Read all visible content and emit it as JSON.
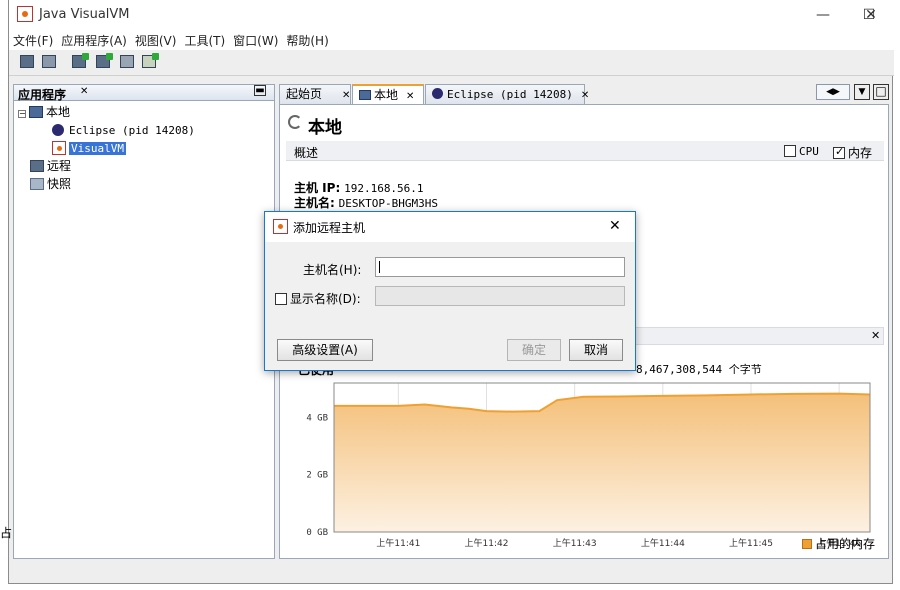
{
  "window": {
    "title": "Java VisualVM",
    "minimize": "—",
    "maximize": "☐",
    "close": "✕"
  },
  "menu": [
    "文件(F)",
    "应用程序(A)",
    "视图(V)",
    "工具(T)",
    "窗口(W)",
    "帮助(H)"
  ],
  "left_panel": {
    "title": "应用程序",
    "close": "✕",
    "minimize": "▬",
    "tree": {
      "local": "本地",
      "eclipse": "Eclipse (pid 14208)",
      "visualvm": "VisualVM",
      "remote": "远程",
      "snapshot": "快照"
    }
  },
  "tabs": [
    {
      "label": "起始页",
      "close": "✕"
    },
    {
      "label": "本地",
      "close": "✕"
    },
    {
      "label": "Eclipse (pid 14208)",
      "close": "✕"
    }
  ],
  "tab_nav": {
    "prev": "◀",
    "next": "▶",
    "menu": "▼",
    "maximize": "□"
  },
  "content": {
    "title": "本地",
    "overview_label": "概述",
    "cpu_label": "CPU",
    "memory_label": "内存",
    "host_ip_label": "主机 IP:",
    "host_ip": "192.168.56.1",
    "host_name_label": "主机名:",
    "host_name": "DESKTOP-BHGM3HS",
    "chart_close": "✕",
    "memory_text_prefix": "已使用",
    "memory_text": "8,467,308,544 个字节",
    "legend": "占用的内存",
    "left_edge_text": "占"
  },
  "dialog": {
    "title": "添加远程主机",
    "close": "✕",
    "host_label": "主机名(H):",
    "host_value": "",
    "display_name_label": "显示名称(D):",
    "advanced_button": "高级设置(A)",
    "ok_button": "确定",
    "cancel_button": "取消"
  },
  "chart_data": {
    "type": "area",
    "x": [
      "上午11:41",
      "上午11:42",
      "上午11:43",
      "上午11:44",
      "上午11:45",
      "上午11:46"
    ],
    "ytick_labels": [
      "0 GB",
      "2 GB",
      "4 GB"
    ],
    "ylim": [
      0,
      5.2
    ],
    "series": [
      {
        "name": "占用的内存",
        "points": [
          [
            0.0,
            4.4
          ],
          [
            0.3,
            4.45
          ],
          [
            0.6,
            4.35
          ],
          [
            0.8,
            4.3
          ],
          [
            1.0,
            4.22
          ],
          [
            1.3,
            4.2
          ],
          [
            1.6,
            4.22
          ],
          [
            1.8,
            4.6
          ],
          [
            2.1,
            4.72
          ],
          [
            2.5,
            4.73
          ],
          [
            3.0,
            4.75
          ],
          [
            3.5,
            4.77
          ],
          [
            4.0,
            4.8
          ],
          [
            4.5,
            4.82
          ],
          [
            5.0,
            4.83
          ],
          [
            5.35,
            4.8
          ]
        ]
      }
    ],
    "xlim": [
      -0.73,
      5.35
    ],
    "grid": true,
    "legend": "bottom-right"
  }
}
